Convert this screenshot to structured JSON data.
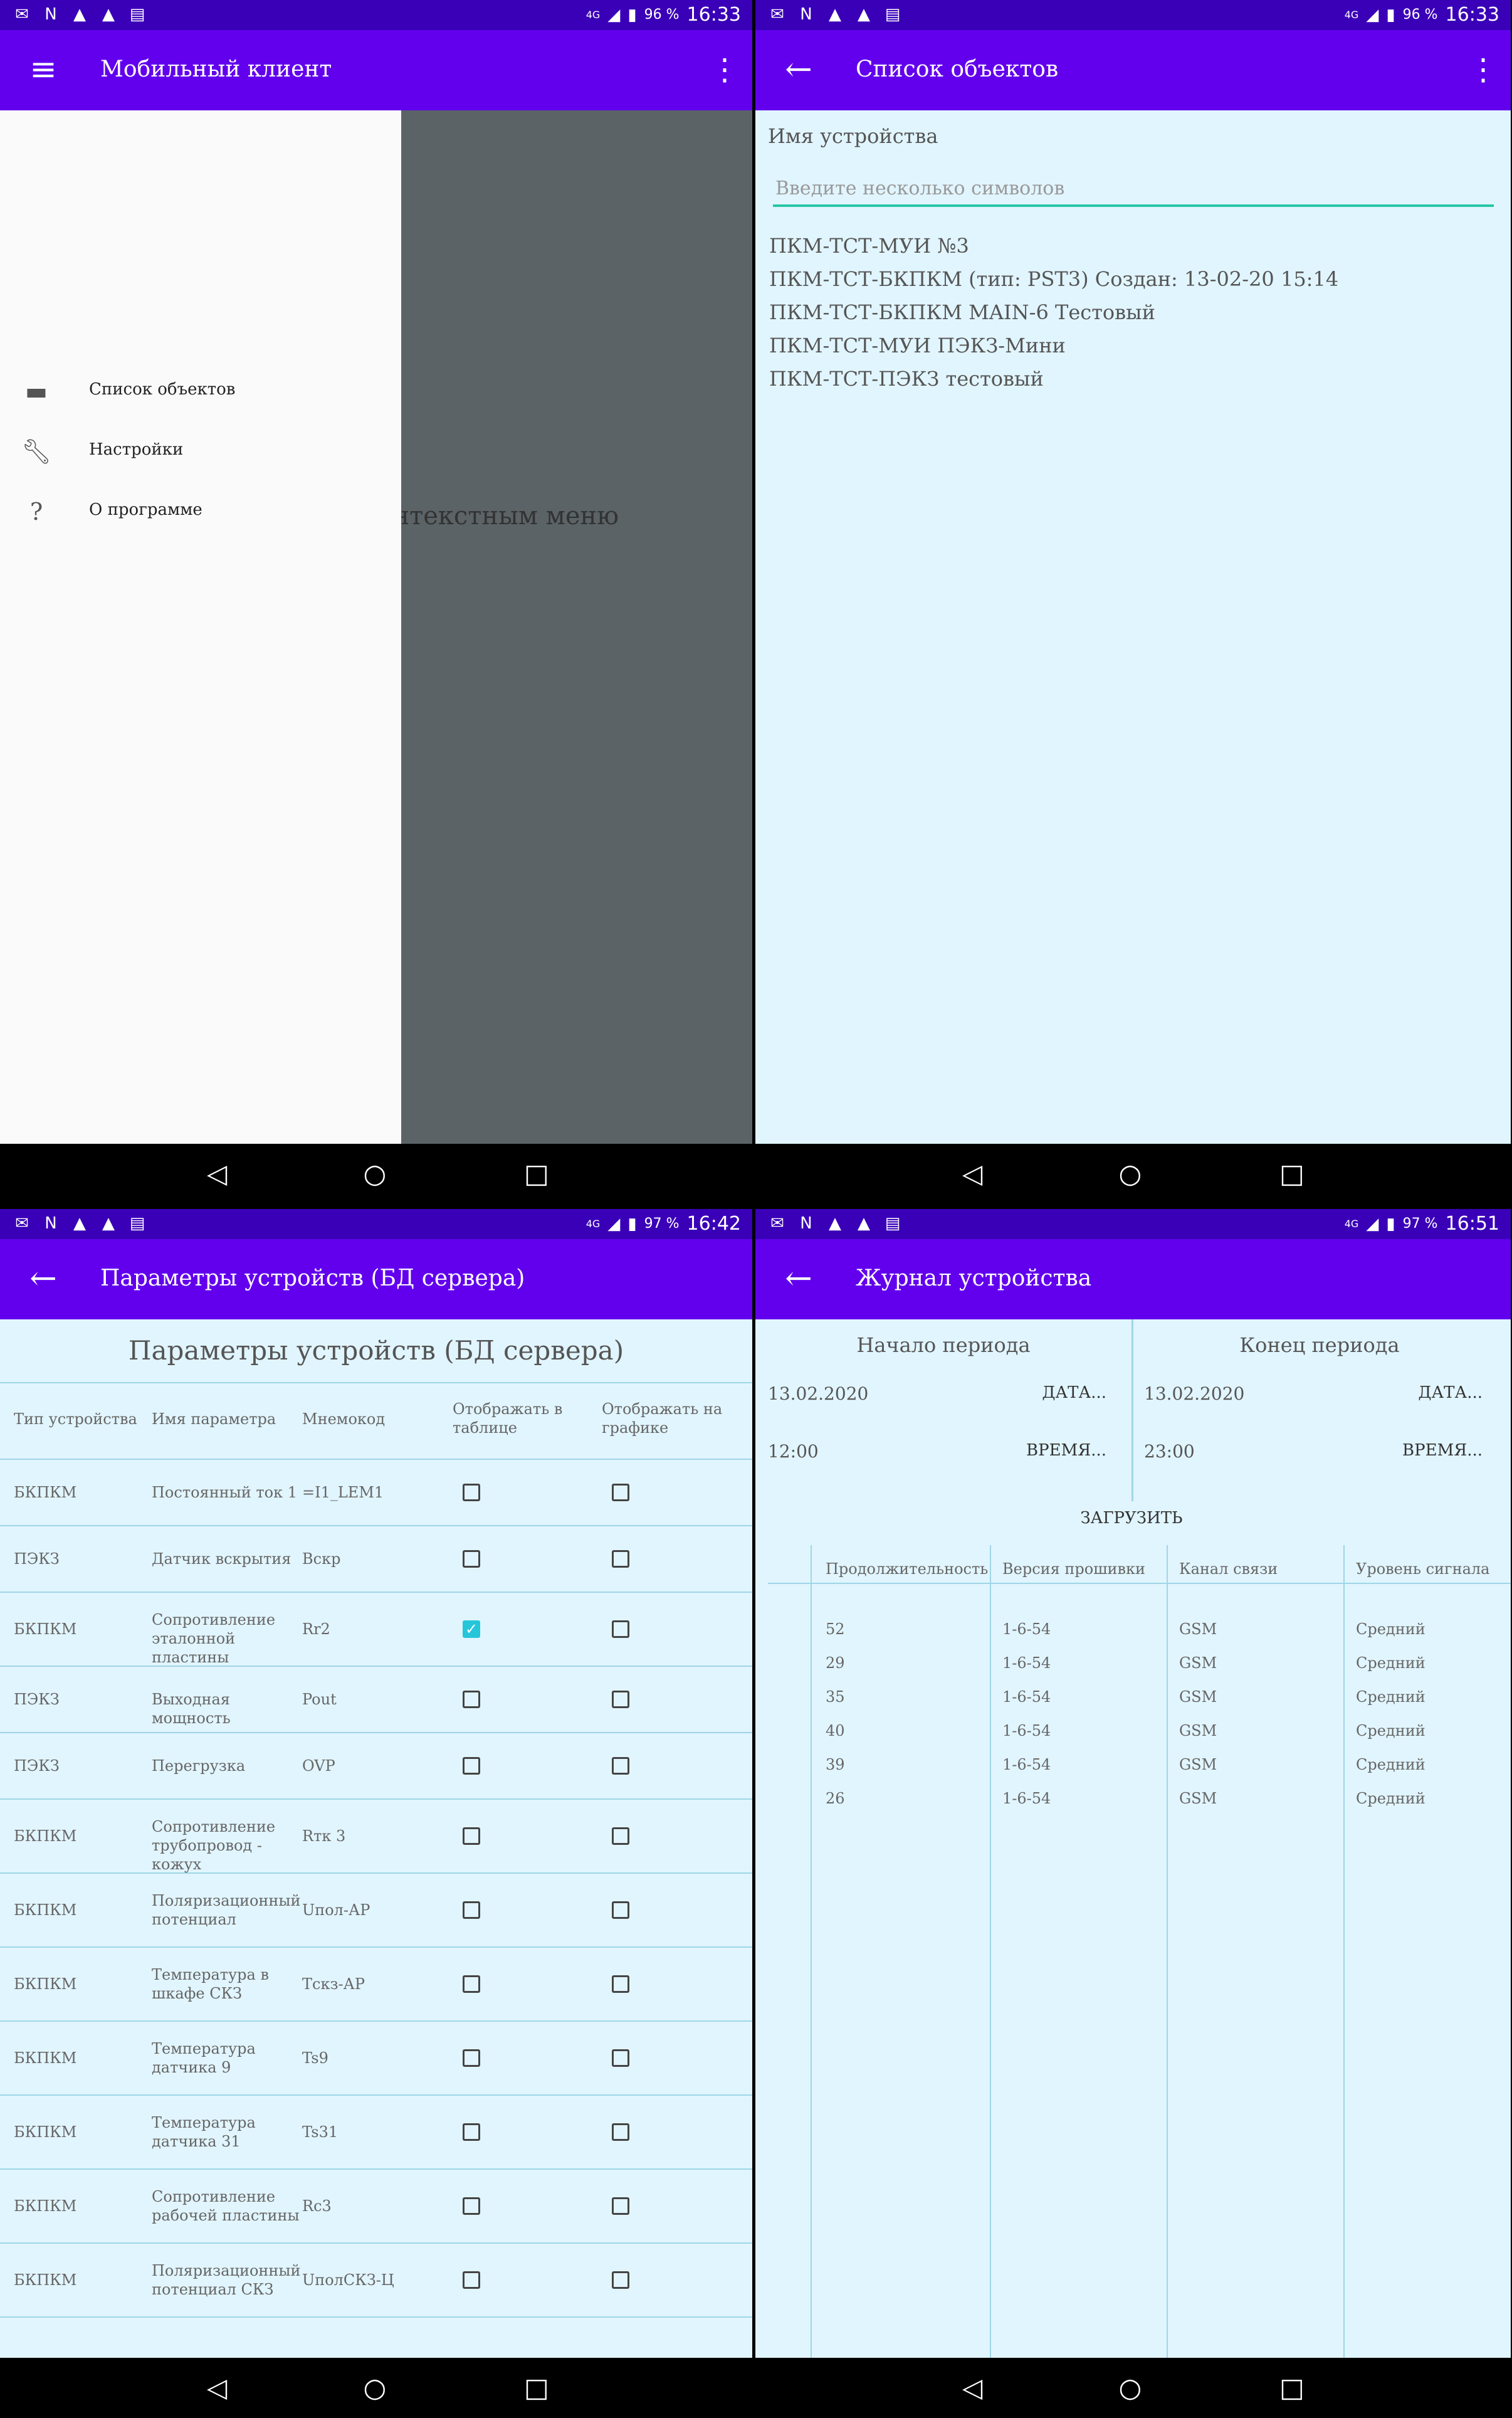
{
  "status_bar": {
    "p1": {
      "battery": "96 %",
      "time": "16:33"
    },
    "p2": {
      "battery": "96 %",
      "time": "16:33"
    },
    "p3": {
      "battery": "97 %",
      "time": "16:42"
    },
    "p4": {
      "battery": "97 %",
      "time": "16:51"
    },
    "network": "4G"
  },
  "screen1": {
    "title": "Мобильный клиент",
    "menu": [
      {
        "label": "Список объектов",
        "icon": "device-icon"
      },
      {
        "label": "Настройки",
        "icon": "wrench-icon"
      },
      {
        "label": "О программе",
        "icon": "help-icon"
      }
    ],
    "hint": "йтесь контекстным меню"
  },
  "screen2": {
    "title": "Список объектов",
    "device_label": "Имя устройства",
    "search_placeholder": "Введите несколько символов",
    "devices": [
      "ПКМ-ТСТ-МУИ №3",
      "ПКМ-ТСТ-БКПКМ (тип: PST3) Создан: 13-02-20 15:14",
      "ПКМ-ТСТ-БКПКМ MAIN-6 Тестовый",
      "ПКМ-ТСТ-МУИ ПЭКЗ-Мини",
      "ПКМ-ТСТ-ПЭКЗ тестовый"
    ]
  },
  "screen3": {
    "title": "Параметры устройств (БД сервера)",
    "header": "Параметры устройств (БД сервера)",
    "columns": [
      "Тип устройства",
      "Имя параметра",
      "Мнемокод",
      "Отображать в таблице",
      "Отображать на графике"
    ],
    "rows": [
      {
        "type": "БКПКМ",
        "name": "Постоянный ток 1",
        "code": "=I1_LEM1",
        "table": false,
        "chart": false
      },
      {
        "type": "ПЭКЗ",
        "name": "Датчик вскрытия",
        "code": "Вскр",
        "table": false,
        "chart": false
      },
      {
        "type": "БКПКМ",
        "name": "Сопротивление эталонной пластины",
        "code": "Rr2",
        "table": true,
        "chart": false
      },
      {
        "type": "ПЭКЗ",
        "name": "Выходная мощность",
        "code": "Pout",
        "table": false,
        "chart": false
      },
      {
        "type": "ПЭКЗ",
        "name": "Перегрузка",
        "code": "OVP",
        "table": false,
        "chart": false
      },
      {
        "type": "БКПКМ",
        "name": "Сопротивление трубопровод - кожух",
        "code": "Rтк 3",
        "table": false,
        "chart": false
      },
      {
        "type": "БКПКМ",
        "name": "Поляризационный потенциал",
        "code": "Uпол-АР",
        "table": false,
        "chart": false
      },
      {
        "type": "БКПКМ",
        "name": "Температура в шкафе СКЗ",
        "code": "Тскз-АР",
        "table": false,
        "chart": false
      },
      {
        "type": "БКПКМ",
        "name": "Температура датчика 9",
        "code": "Ts9",
        "table": false,
        "chart": false
      },
      {
        "type": "БКПКМ",
        "name": "Температура датчика 31",
        "code": "Ts31",
        "table": false,
        "chart": false
      },
      {
        "type": "БКПКМ",
        "name": "Сопротивление рабочей пластины",
        "code": "Rс3",
        "table": false,
        "chart": false
      },
      {
        "type": "БКПКМ",
        "name": "Поляризационный потенциал СКЗ",
        "code": "UполСКЗ-Ц",
        "table": false,
        "chart": false
      }
    ]
  },
  "screen4": {
    "title": "Журнал устройства",
    "start": {
      "title": "Начало периода",
      "date": "13.02.2020",
      "date_btn": "ДАТА...",
      "time": "12:00",
      "time_btn": "ВРЕМЯ..."
    },
    "end": {
      "title": "Конец периода",
      "date": "13.02.2020",
      "date_btn": "ДАТА...",
      "time": "23:00",
      "time_btn": "ВРЕМЯ..."
    },
    "load_label": "Загрузить",
    "columns": [
      "Продолжительность",
      "Версия прошивки",
      "Канал связи",
      "Уровень сигнала"
    ],
    "rows": [
      [
        "52",
        "1-6-54",
        "GSM",
        "Средний"
      ],
      [
        "29",
        "1-6-54",
        "GSM",
        "Средний"
      ],
      [
        "35",
        "1-6-54",
        "GSM",
        "Средний"
      ],
      [
        "40",
        "1-6-54",
        "GSM",
        "Средний"
      ],
      [
        "39",
        "1-6-54",
        "GSM",
        "Средний"
      ],
      [
        "26",
        "1-6-54",
        "GSM",
        "Средний"
      ]
    ]
  }
}
